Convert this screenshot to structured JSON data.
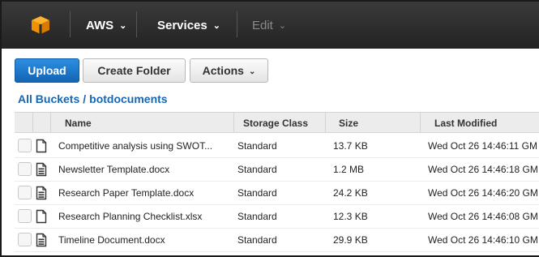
{
  "nav": {
    "logo_icon": "aws-cube-icon",
    "items": [
      {
        "label": "AWS"
      },
      {
        "label": "Services"
      },
      {
        "label": "Edit"
      }
    ]
  },
  "toolbar": {
    "upload_label": "Upload",
    "create_folder_label": "Create Folder",
    "actions_label": "Actions"
  },
  "breadcrumb": {
    "root": "All Buckets",
    "separator": "/",
    "current": "botdocuments"
  },
  "table": {
    "columns": {
      "name": "Name",
      "storage_class": "Storage Class",
      "size": "Size",
      "last_modified": "Last Modified"
    },
    "rows": [
      {
        "icon": "blank-file-icon",
        "name": "Competitive analysis using SWOT...",
        "storage_class": "Standard",
        "size": "13.7 KB",
        "last_modified": "Wed Oct 26 14:46:11 GM"
      },
      {
        "icon": "document-file-icon",
        "name": "Newsletter Template.docx",
        "storage_class": "Standard",
        "size": "1.2 MB",
        "last_modified": "Wed Oct 26 14:46:18 GM"
      },
      {
        "icon": "document-file-icon",
        "name": "Research Paper Template.docx",
        "storage_class": "Standard",
        "size": "24.2 KB",
        "last_modified": "Wed Oct 26 14:46:20 GM"
      },
      {
        "icon": "blank-file-icon",
        "name": "Research Planning Checklist.xlsx",
        "storage_class": "Standard",
        "size": "12.3 KB",
        "last_modified": "Wed Oct 26 14:46:08 GM"
      },
      {
        "icon": "document-file-icon",
        "name": "Timeline Document.docx",
        "storage_class": "Standard",
        "size": "29.9 KB",
        "last_modified": "Wed Oct 26 14:46:10 GM"
      }
    ]
  },
  "colors": {
    "topbar": "#2b2b2b",
    "primary_button": "#1a73c9",
    "link": "#1666b5",
    "logo_orange": "#f29100"
  }
}
